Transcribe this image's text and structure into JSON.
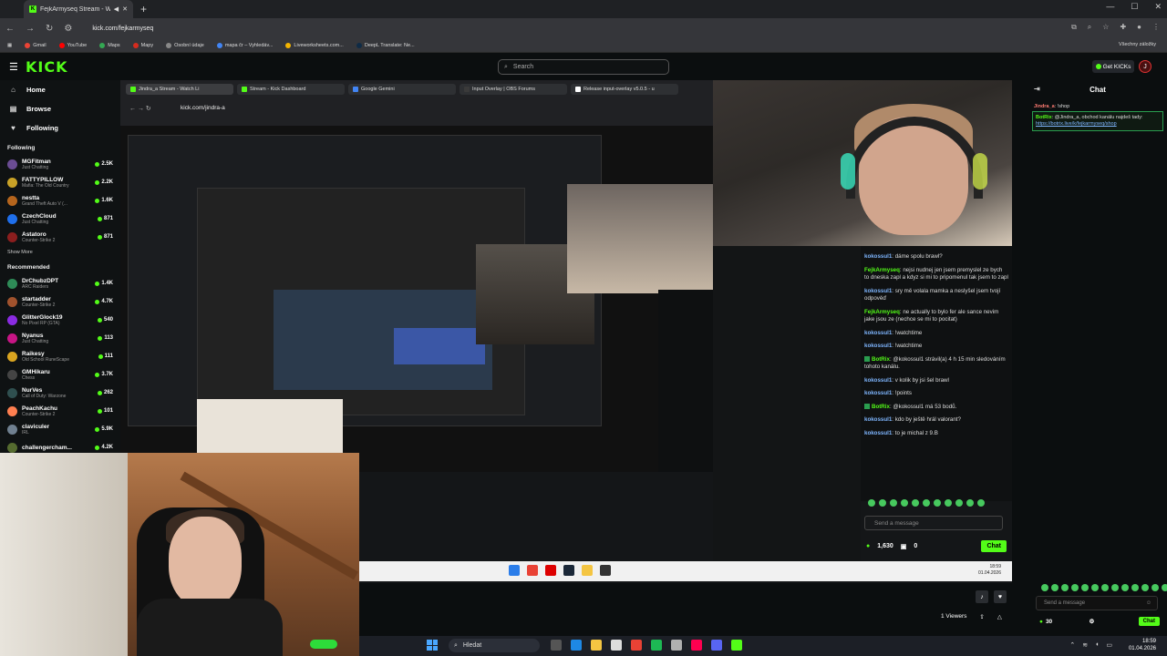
{
  "browser": {
    "tab_title": "FejkArmyseq Stream - Wat",
    "url": "kick.com/fejkarmyseq",
    "bookmarks": [
      {
        "label": "Gmail",
        "color": "#ea4335"
      },
      {
        "label": "YouTube",
        "color": "#ff0000"
      },
      {
        "label": "Maps",
        "color": "#34a853"
      },
      {
        "label": "Mapy",
        "color": "#d52b1e"
      },
      {
        "label": "Osobní údaje",
        "color": "#888888"
      },
      {
        "label": "mapa čr – Vyhledáv...",
        "color": "#4285f4"
      },
      {
        "label": "Liveworksheets.com...",
        "color": "#f4b400"
      },
      {
        "label": "DeepL Translate: Ne...",
        "color": "#0f2b46"
      }
    ],
    "bookmarks_right": "Všechny záložky"
  },
  "kick": {
    "logo": "KICK",
    "search_placeholder": "Search",
    "get_kicks": "Get KICKs",
    "avatar_letter": "J"
  },
  "sidebar": {
    "nav": [
      {
        "label": "Home",
        "icon": "home-icon",
        "glyph": "⌂"
      },
      {
        "label": "Browse",
        "icon": "browse-icon",
        "glyph": "▤"
      },
      {
        "label": "Following",
        "icon": "heart-icon",
        "glyph": "♥"
      }
    ],
    "following_title": "Following",
    "following": [
      {
        "name": "MGFitman",
        "category": "Just Chatting",
        "viewers": "2.5K",
        "color": "#6a4c93"
      },
      {
        "name": "FATTYPILLOW",
        "category": "Mafia: The Old Country",
        "viewers": "2.2K",
        "color": "#c9a227"
      },
      {
        "name": "nestta",
        "category": "Grand Theft Auto V (...",
        "viewers": "1.6K",
        "color": "#b5651d"
      },
      {
        "name": "CzechCloud",
        "category": "Just Chatting",
        "viewers": "871",
        "color": "#1f6feb"
      },
      {
        "name": "Astatoro",
        "category": "Counter-Strike 2",
        "viewers": "871",
        "color": "#8b1e1e"
      }
    ],
    "show_more": "Show More",
    "recommended_title": "Recommended",
    "recommended": [
      {
        "name": "DrChubzDPT",
        "category": "ARC Raiders",
        "viewers": "1.4K",
        "color": "#2e8b57"
      },
      {
        "name": "startadder",
        "category": "Counter-Strike 2",
        "viewers": "4.7K",
        "color": "#a0522d"
      },
      {
        "name": "GlitterGlock19",
        "category": "No Pixel RP (GTA)",
        "viewers": "540",
        "color": "#8a2be2"
      },
      {
        "name": "Nyanus",
        "category": "Just Chatting",
        "viewers": "113",
        "color": "#c71585"
      },
      {
        "name": "Raikesy",
        "category": "Old School RuneScape",
        "viewers": "111",
        "color": "#daa520"
      },
      {
        "name": "GMHikaru",
        "category": "Chess",
        "viewers": "3.7K",
        "color": "#444444"
      },
      {
        "name": "NurVes",
        "category": "Call of Duty: Warzone",
        "viewers": "262",
        "color": "#2f4f4f"
      },
      {
        "name": "PeachKachu",
        "category": "Counter-Strike 2",
        "viewers": "101",
        "color": "#ff7f50"
      },
      {
        "name": "claviculer",
        "category": "IRL",
        "viewers": "5.9K",
        "color": "#708090"
      },
      {
        "name": "challengercham...",
        "category": "",
        "viewers": "4.2K",
        "color": "#556b2f"
      }
    ]
  },
  "video": {
    "inner_tabs": [
      {
        "title": "Jindra_a Stream - Watch Li",
        "color": "#53fc18"
      },
      {
        "title": "Stream - Kick Dashboard",
        "color": "#53fc18"
      },
      {
        "title": "Google Gemini",
        "color": "#4285f4"
      },
      {
        "title": "Input Overlay | OBS Forums",
        "color": "#3a3a3a"
      },
      {
        "title": "Release input-overlay v5.0.5 - u",
        "color": "#ffffff"
      }
    ],
    "inner_url": "kick.com/jindra-a",
    "inner_chat": [
      {
        "user": "kokossul1",
        "text": "dáme spolu brawl?",
        "color": "#7fb6ff",
        "bot": false
      },
      {
        "user": "FejkArmyseq",
        "text": "nejsi nudnej jen jsem premyslel ze bych to dneska zapl a kdyz si mi to pripomenul tak jsem to zapl",
        "color": "#53fc18",
        "bot": false
      },
      {
        "user": "kokossul1",
        "text": "sry mě volala mamka a neslyšel jsem tvojí odpověď",
        "color": "#7fb6ff",
        "bot": false
      },
      {
        "user": "FejkArmyseq",
        "text": "ne actually to bylo fer ale sance nevim jake jsou ze (nechce se mi to pocitat)",
        "color": "#53fc18",
        "bot": false
      },
      {
        "user": "kokossul1",
        "text": "!watchtime",
        "color": "#7fb6ff",
        "bot": false
      },
      {
        "user": "kokossul1",
        "text": "!watchtime",
        "color": "#7fb6ff",
        "bot": false
      },
      {
        "user": "BotRix",
        "text": "@kokossul1 strávil(a) 4 h 15 min sledováním tohoto kanálu.",
        "color": "#53fc18",
        "bot": true
      },
      {
        "user": "kokossul1",
        "text": "v kolik by jsi šel brawl",
        "color": "#7fb6ff",
        "bot": false
      },
      {
        "user": "kokossul1",
        "text": "!points",
        "color": "#7fb6ff",
        "bot": false
      },
      {
        "user": "BotRix",
        "text": "@kokossul1 má 53 bodů.",
        "color": "#53fc18",
        "bot": true
      },
      {
        "user": "kokossul1",
        "text": "kdo by ještě hrál valorant?",
        "color": "#7fb6ff",
        "bot": false
      },
      {
        "user": "kokossul1",
        "text": "to je michal z 9.B",
        "color": "#7fb6ff",
        "bot": false
      }
    ],
    "inner_send": "Send a message",
    "inner_points": "1,630",
    "inner_zero": "0",
    "inner_chat_btn": "Chat",
    "inner_clock_time": "18:59",
    "inner_clock_date": "01.04.2026"
  },
  "player": {
    "viewers": "1 Viewers"
  },
  "chat": {
    "title": "Chat",
    "first_user": "Jindra_a",
    "first_text": ": !shop",
    "pinned_user": "BotRix",
    "pinned_text": ": @Jindra_a, obchod kanálu najdeš tady: ",
    "pinned_link": "https://botrix.live/k/fejkarmyseq/shop",
    "placeholder": "Send a message",
    "points": "30",
    "chat_btn": "Chat"
  },
  "os": {
    "search": "Hledat",
    "time": "18:59",
    "date": "01.04.2026"
  }
}
